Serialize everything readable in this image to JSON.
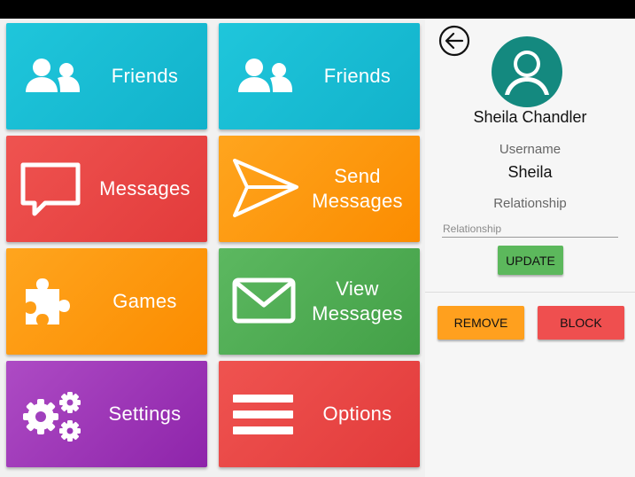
{
  "tiles": [
    {
      "label": "Friends",
      "icon": "people-icon",
      "color": "#1fc6db"
    },
    {
      "label": "Friends",
      "icon": "people-icon",
      "color": "#1fc6db"
    },
    {
      "label": "Messages",
      "icon": "chat-bubble-icon",
      "color": "#ef5350"
    },
    {
      "label": "Send\nMessages",
      "icon": "send-icon",
      "color": "#fb8c00"
    },
    {
      "label": "Games",
      "icon": "puzzle-icon",
      "color": "#fb8c00"
    },
    {
      "label": "View\nMessages",
      "icon": "envelope-icon",
      "color": "#43a047"
    },
    {
      "label": "Settings",
      "icon": "gears-icon",
      "color": "#8e24aa"
    },
    {
      "label": "Options",
      "icon": "menu-icon",
      "color": "#e53935"
    }
  ],
  "profile": {
    "back_icon": "back-arrow-icon",
    "avatar_icon": "avatar-icon",
    "avatar_color": "#14897f",
    "name": "Sheila Chandler",
    "username_caption": "Username",
    "username": "Sheila",
    "relationship_caption": "Relationship",
    "relationship_placeholder": "Relationship",
    "relationship_value": "",
    "update_label": "UPDATE",
    "remove_label": "REMOVE",
    "block_label": "BLOCK"
  }
}
